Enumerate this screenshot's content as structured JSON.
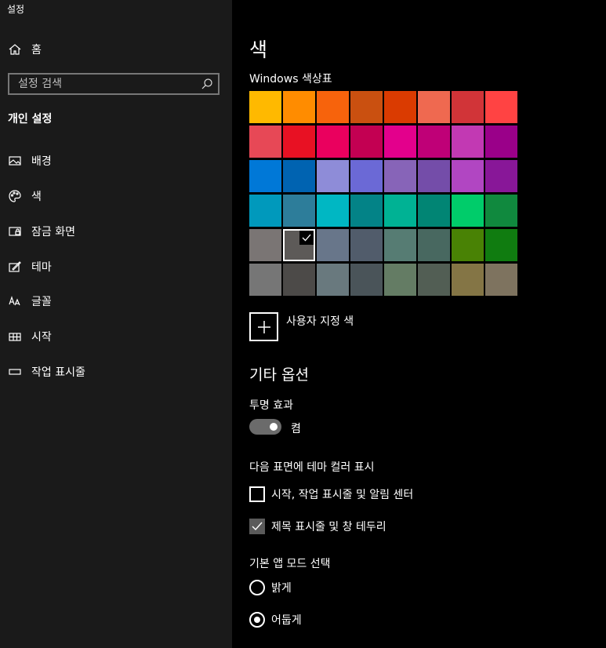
{
  "app": {
    "title": "설정"
  },
  "sidebar": {
    "home": {
      "label": "홈",
      "icon": "home-icon"
    },
    "search": {
      "placeholder": "설정 검색",
      "value": "",
      "icon": "search-icon"
    },
    "section_title": "개인 설정",
    "items": [
      {
        "key": "background",
        "label": "배경",
        "icon": "image-icon"
      },
      {
        "key": "colors",
        "label": "색",
        "icon": "palette-icon"
      },
      {
        "key": "lockscreen",
        "label": "잠금 화면",
        "icon": "lock-screen-icon"
      },
      {
        "key": "themes",
        "label": "테마",
        "icon": "theme-icon"
      },
      {
        "key": "fonts",
        "label": "글꼴",
        "icon": "font-icon"
      },
      {
        "key": "start",
        "label": "시작",
        "icon": "start-icon"
      },
      {
        "key": "taskbar",
        "label": "작업 표시줄",
        "icon": "taskbar-icon"
      }
    ]
  },
  "main": {
    "title": "색",
    "palette_label": "Windows 색상표",
    "palette": [
      [
        "#FFB900",
        "#FF8C00",
        "#F7630C",
        "#CA5010",
        "#DA3B01",
        "#EF6950",
        "#D13438",
        "#FF4343"
      ],
      [
        "#E74856",
        "#E81123",
        "#EA005E",
        "#C30052",
        "#E3008C",
        "#BF0077",
        "#C239B3",
        "#9A0089"
      ],
      [
        "#0078D7",
        "#0063B1",
        "#8E8CD8",
        "#6B69D6",
        "#8764B8",
        "#744DA9",
        "#B146C2",
        "#881798"
      ],
      [
        "#0099BC",
        "#2D7D9A",
        "#00B7C3",
        "#038387",
        "#00B294",
        "#018574",
        "#00CC6A",
        "#10893E"
      ],
      [
        "#7A7574",
        "#5D5A58",
        "#68768A",
        "#515C6B",
        "#567C73",
        "#486860",
        "#498205",
        "#107C10"
      ],
      [
        "#767676",
        "#4C4A48",
        "#69797E",
        "#4A5459",
        "#647C64",
        "#525E54",
        "#847545",
        "#7E735F"
      ]
    ],
    "selected_swatch": {
      "row": 4,
      "col": 1
    },
    "custom_color_label": "사용자 지정 색",
    "more_options_title": "기타 옵션",
    "transparency": {
      "label": "투명 효과",
      "state_text": "켬",
      "on": true
    },
    "accent_surfaces": {
      "label": "다음 표면에 테마 컬러 표시",
      "options": [
        {
          "label": "시작, 작업 표시줄 및 알림 센터",
          "checked": false
        },
        {
          "label": "제목 표시줄 및 창 테두리",
          "checked": true
        }
      ]
    },
    "app_mode": {
      "label": "기본 앱 모드 선택",
      "options": [
        {
          "label": "밝게",
          "selected": false
        },
        {
          "label": "어둡게",
          "selected": true
        }
      ]
    }
  }
}
